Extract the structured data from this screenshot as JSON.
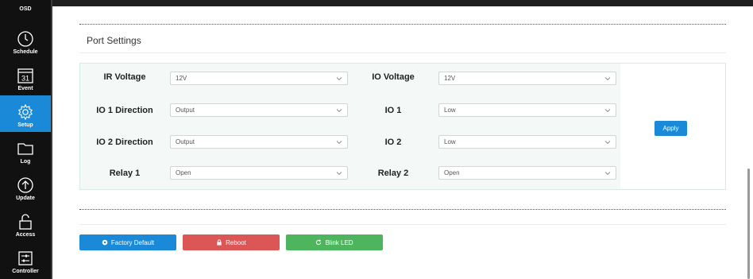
{
  "sidebar": {
    "top_label": "OSD",
    "items": [
      {
        "label": "Schedule",
        "icon": "clock-icon"
      },
      {
        "label": "Event",
        "icon": "calendar-icon",
        "icon_text": "31"
      },
      {
        "label": "Setup",
        "icon": "gear-icon",
        "active": true
      },
      {
        "label": "Log",
        "icon": "folder-icon"
      },
      {
        "label": "Update",
        "icon": "upload-icon"
      },
      {
        "label": "Access",
        "icon": "lock-icon"
      },
      {
        "label": "Controller",
        "icon": "sliders-icon"
      }
    ],
    "active_color": "#1a8ad8"
  },
  "section": {
    "title": "Port Settings"
  },
  "port_settings": {
    "rows": [
      {
        "left_label": "IR Voltage",
        "left_value": "12V",
        "right_label": "IO Voltage",
        "right_value": "12V"
      },
      {
        "left_label": "IO 1 Direction",
        "left_value": "Output",
        "right_label": "IO 1",
        "right_value": "Low"
      },
      {
        "left_label": "IO 2 Direction",
        "left_value": "Output",
        "right_label": "IO 2",
        "right_value": "Low"
      },
      {
        "left_label": "Relay 1",
        "left_value": "Open",
        "right_label": "Relay 2",
        "right_value": "Open"
      }
    ],
    "apply_label": "Apply"
  },
  "actions": {
    "factory_default_label": "Factory Default",
    "reboot_label": "Reboot",
    "blink_led_label": "Blink LED"
  },
  "colors": {
    "primary": "#1a8ad8",
    "danger": "#dc5656",
    "success": "#4cb55e"
  }
}
